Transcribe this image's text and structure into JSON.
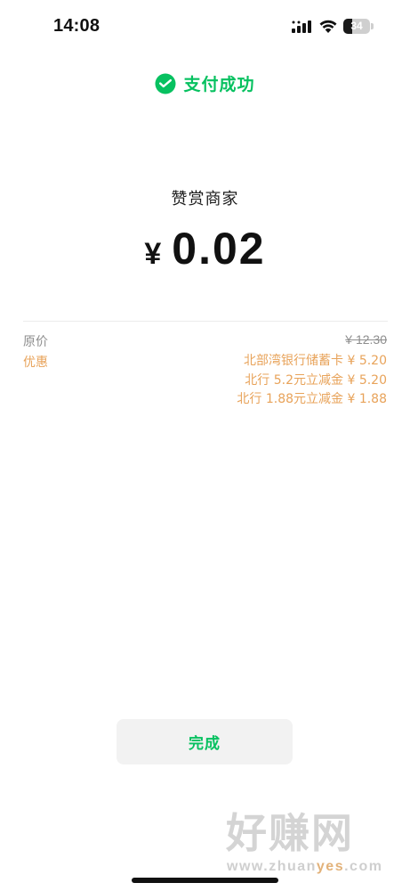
{
  "status_bar": {
    "time": "14:08",
    "battery_level": "34",
    "battery_fraction": 0.34,
    "icons": [
      "signal-icon",
      "wifi-icon",
      "battery-icon"
    ]
  },
  "header": {
    "icon": "wechat-pay-icon",
    "success_text": "支付成功"
  },
  "payment": {
    "merchant": "赞赏商家",
    "currency_symbol": "¥",
    "amount": "0.02"
  },
  "details": {
    "original_label": "原价",
    "original_value": "¥ 12.30",
    "discount_label": "优惠",
    "discounts": [
      "北部湾银行储蓄卡 ¥ 5.20",
      "北行 5.2元立减金 ¥ 5.20",
      "北行 1.88元立减金 ¥ 1.88"
    ]
  },
  "actions": {
    "done_label": "完成"
  },
  "watermark": {
    "text": "好赚网",
    "url_prefix": "www.zhuan",
    "url_highlight": "yes",
    "url_suffix": ".com"
  },
  "colors": {
    "accent_green": "#07c160",
    "discount_orange": "#e8a35a",
    "muted_gray": "#8e8e8e"
  }
}
